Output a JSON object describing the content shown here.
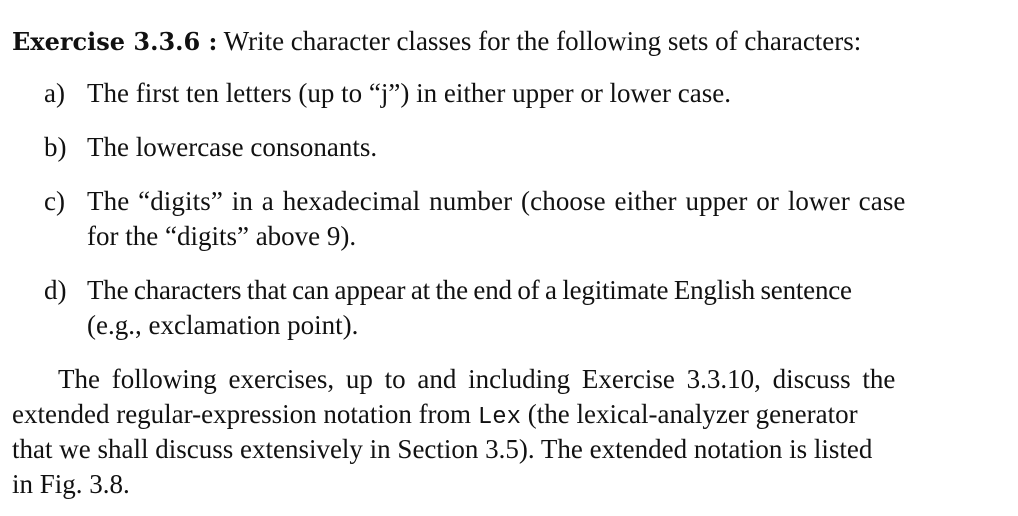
{
  "exercise": {
    "label": "Exercise 3.3.6 :",
    "intro": " Write character classes for the following sets of characters:",
    "items": [
      {
        "marker": "a)",
        "lines": [
          "The first ten letters (up to “j”) in either upper or lower case."
        ]
      },
      {
        "marker": "b)",
        "lines": [
          "The lowercase consonants."
        ]
      },
      {
        "marker": "c)",
        "lines": [
          "The “digits” in a hexadecimal number (choose either upper or lower case",
          "for the “digits” above 9)."
        ]
      },
      {
        "marker": "d)",
        "lines": [
          "The characters that can appear at the end of a legitimate English sentence",
          "(e.g., exclamation point)."
        ]
      }
    ]
  },
  "paragraph": {
    "line1": "The following exercises, up to and including Exercise 3.3.10, discuss the",
    "line2_before": "extended regular-expression notation from ",
    "line2_code": "Lex",
    "line2_after": " (the lexical-analyzer generator",
    "line3": "that we shall discuss extensively in Section 3.5). The extended notation is listed",
    "line4": "in Fig. 3.8."
  }
}
